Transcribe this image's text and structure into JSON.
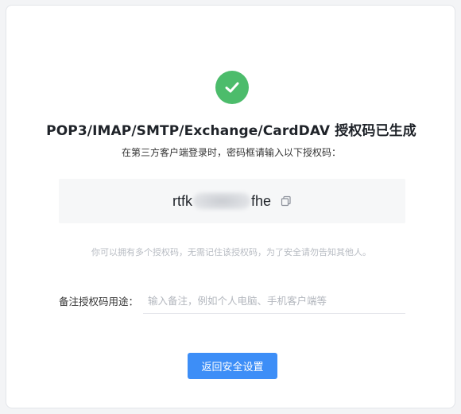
{
  "status": {
    "icon": "check-circle-icon",
    "color": "#4cbc6b"
  },
  "title": "POP3/IMAP/SMTP/Exchange/CardDAV 授权码已生成",
  "subtitle": "在第三方客户端登录时，密码框请输入以下授权码：",
  "auth_code": {
    "prefix": "rtfk",
    "suffix": "fhe",
    "copy_icon": "copy-icon"
  },
  "hint": "你可以拥有多个授权码，无需记住该授权码，为了安全请勿告知其他人。",
  "remark": {
    "label": "备注授权码用途：",
    "value": "",
    "placeholder": "输入备注，例如个人电脑、手机客户端等"
  },
  "back_button": {
    "label": "返回安全设置",
    "color": "#3d8ef7"
  }
}
